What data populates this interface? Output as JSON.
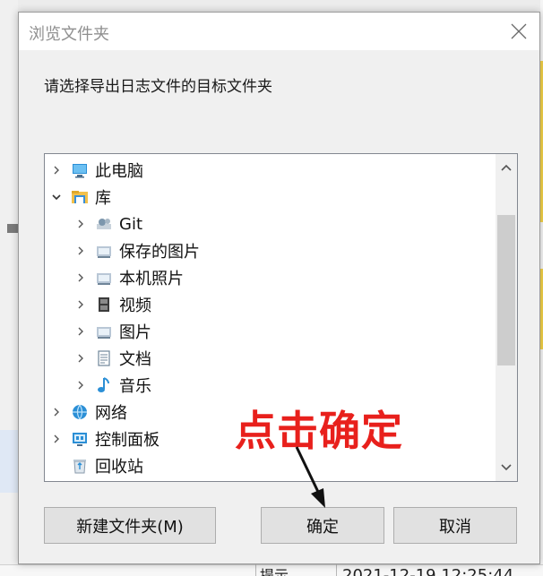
{
  "dialog": {
    "title": "浏览文件夹",
    "instruction": "请选择导出日志文件的目标文件夹"
  },
  "tree": {
    "items": [
      {
        "label": "此电脑",
        "icon": "computer-icon",
        "expanded": false
      },
      {
        "label": "库",
        "icon": "library-folder-icon",
        "expanded": true
      },
      {
        "label": "Git",
        "icon": "git-library-icon",
        "expanded": false
      },
      {
        "label": "保存的图片",
        "icon": "saved-pictures-icon",
        "expanded": false
      },
      {
        "label": "本机照片",
        "icon": "camera-roll-icon",
        "expanded": false
      },
      {
        "label": "视频",
        "icon": "videos-icon",
        "expanded": false
      },
      {
        "label": "图片",
        "icon": "pictures-icon",
        "expanded": false
      },
      {
        "label": "文档",
        "icon": "documents-icon",
        "expanded": false
      },
      {
        "label": "音乐",
        "icon": "music-icon",
        "expanded": false
      },
      {
        "label": "网络",
        "icon": "network-icon",
        "expanded": false
      },
      {
        "label": "控制面板",
        "icon": "control-panel-icon",
        "expanded": false
      },
      {
        "label": "回收站",
        "icon": "recycle-bin-icon",
        "expanded": null
      }
    ]
  },
  "buttons": {
    "new_folder": "新建文件夹(M)",
    "ok": "确定",
    "cancel": "取消"
  },
  "annotation": {
    "text": "点击确定",
    "color": "#e8201c"
  },
  "background": {
    "status_label": "提示",
    "timestamp": "2021-12-19 12:25:44"
  }
}
